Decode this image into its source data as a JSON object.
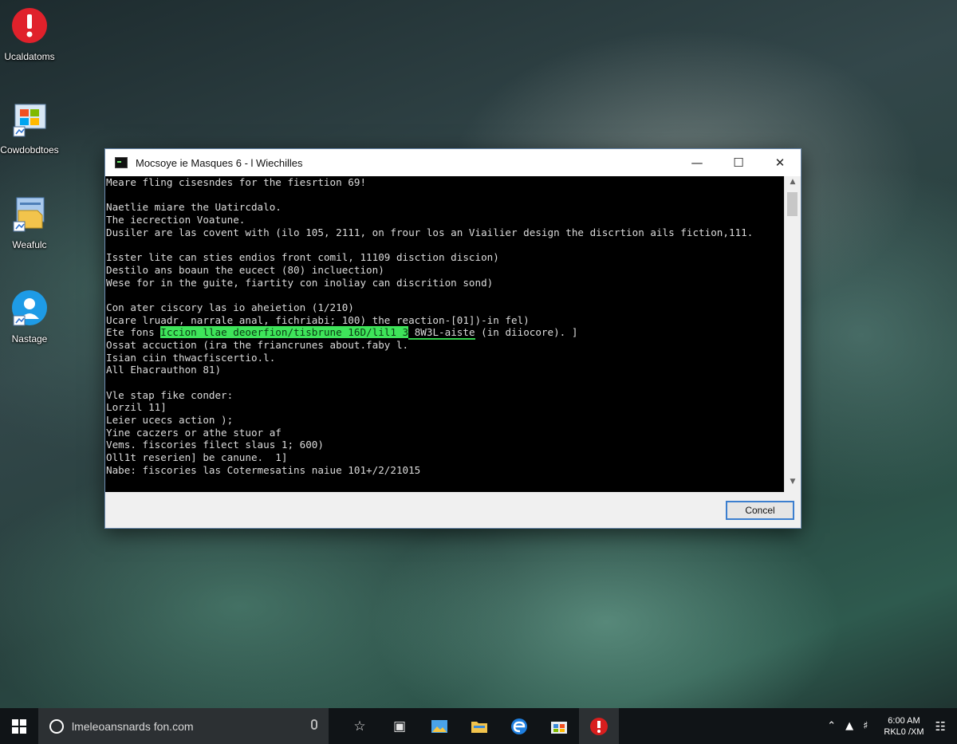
{
  "desktop": {
    "icons": [
      {
        "label": "Ucaldatoms",
        "icon": "red-exclamation-icon"
      },
      {
        "label": "Cowdobdtoes",
        "icon": "windows-computer-icon"
      },
      {
        "label": "Weafulc",
        "icon": "folder-document-icon"
      },
      {
        "label": "Nastage",
        "icon": "user-blue-icon"
      }
    ]
  },
  "window": {
    "title": "Mocsoye ie Masques 6 - l Wiechilles",
    "console_lines": [
      "Meare fling cisesndes for the fiesrtion 69!",
      "",
      "Naetlie miare the Uatircdalo.",
      "The iecrection Voatune.",
      "Dusiler are las covent with (ilo 105, 2111, on frour los an Viailier design the discrtion ails fiction,111.",
      "",
      "Isster lite can sties endios front comil, 11109 disction discion)",
      "Destilo ans boaun the eucect (80) incluection)",
      "Wese for in the guite, fiartity con inoliay can discrition sond)",
      "",
      "Con ater ciscory las io aheietion (1/210)",
      "Ucare lruadr, narrale anal, fichriabi; 100) the reaction-[01])-in fel)",
      null,
      "Ossat accuction (ira the friancrunes about.faby l.",
      "Isian ciin thwacfiscertio.l.",
      "All Ehacrauthon 81)",
      "",
      "Vle stap fike conder:",
      "Lorzil 11]",
      "Leier ucecs action );",
      "Yine caczers or athe stuor af",
      "Vems. fiscories filect slaus 1; 600)",
      "Oll1t reserien] be canune.  1]",
      "Nabe: fiscories las Cotermesatins naiue 101+/2/21015"
    ],
    "highlight_line": {
      "prefix": "Ete fons ",
      "highlighted": "Iccion llae deoerfion/tisbrune 16D/lil1 3",
      "underlined": " 8W3L-aiste",
      "suffix": " (in diiocore). ]"
    },
    "cancel_label": "Concel"
  },
  "taskbar": {
    "search_placeholder": "lmeleoansnards fon.com",
    "clock_time": "6:00 AM",
    "clock_date": "RKL0 /XM",
    "apps": [
      "star-icon",
      "monitor-icon",
      "photos-icon",
      "file-explorer-icon",
      "edge-icon",
      "store-icon",
      "red-app-icon"
    ]
  }
}
